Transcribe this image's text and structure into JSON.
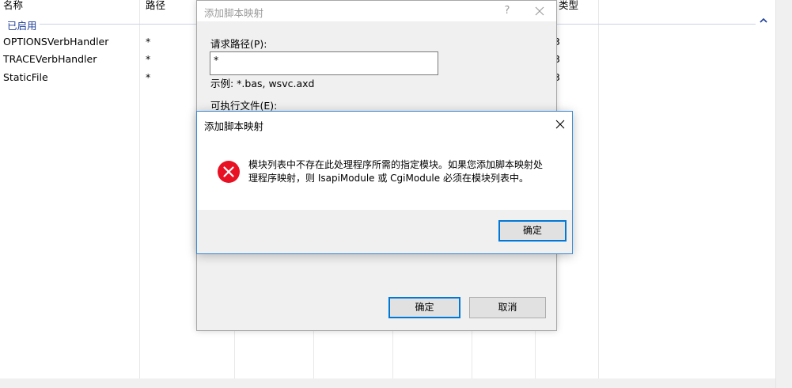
{
  "list": {
    "columns": [
      {
        "label": "名称"
      },
      {
        "label": "路径"
      },
      {
        "label": "类型"
      }
    ],
    "group": {
      "label": "已启用"
    },
    "rows": [
      {
        "name": "OPTIONSVerbHandler",
        "path": "*",
        "type_fragment": "3"
      },
      {
        "name": "TRACEVerbHandler",
        "path": "*",
        "type_fragment": "3"
      },
      {
        "name": "StaticFile",
        "path": "*",
        "type_fragment": "3"
      }
    ]
  },
  "back_dialog": {
    "title": "添加脚本映射",
    "help_label": "?",
    "request_path_label": "请求路径(P):",
    "request_path_value": "*",
    "example_text": "示例: *.bas, wsvc.axd",
    "executable_label": "可执行文件(E):",
    "ok_label": "确定",
    "cancel_label": "取消"
  },
  "error_box": {
    "title": "添加脚本映射",
    "message_line1": "模块列表中不存在此处理程序所需的指定模块。如果您添加脚本映射处",
    "message_line2": "理程序映射，则 IsapiModule 或 CgiModule 必须在模块列表中。",
    "ok_label": "确定",
    "icon": "error-icon",
    "accent_color": "#e81123"
  }
}
